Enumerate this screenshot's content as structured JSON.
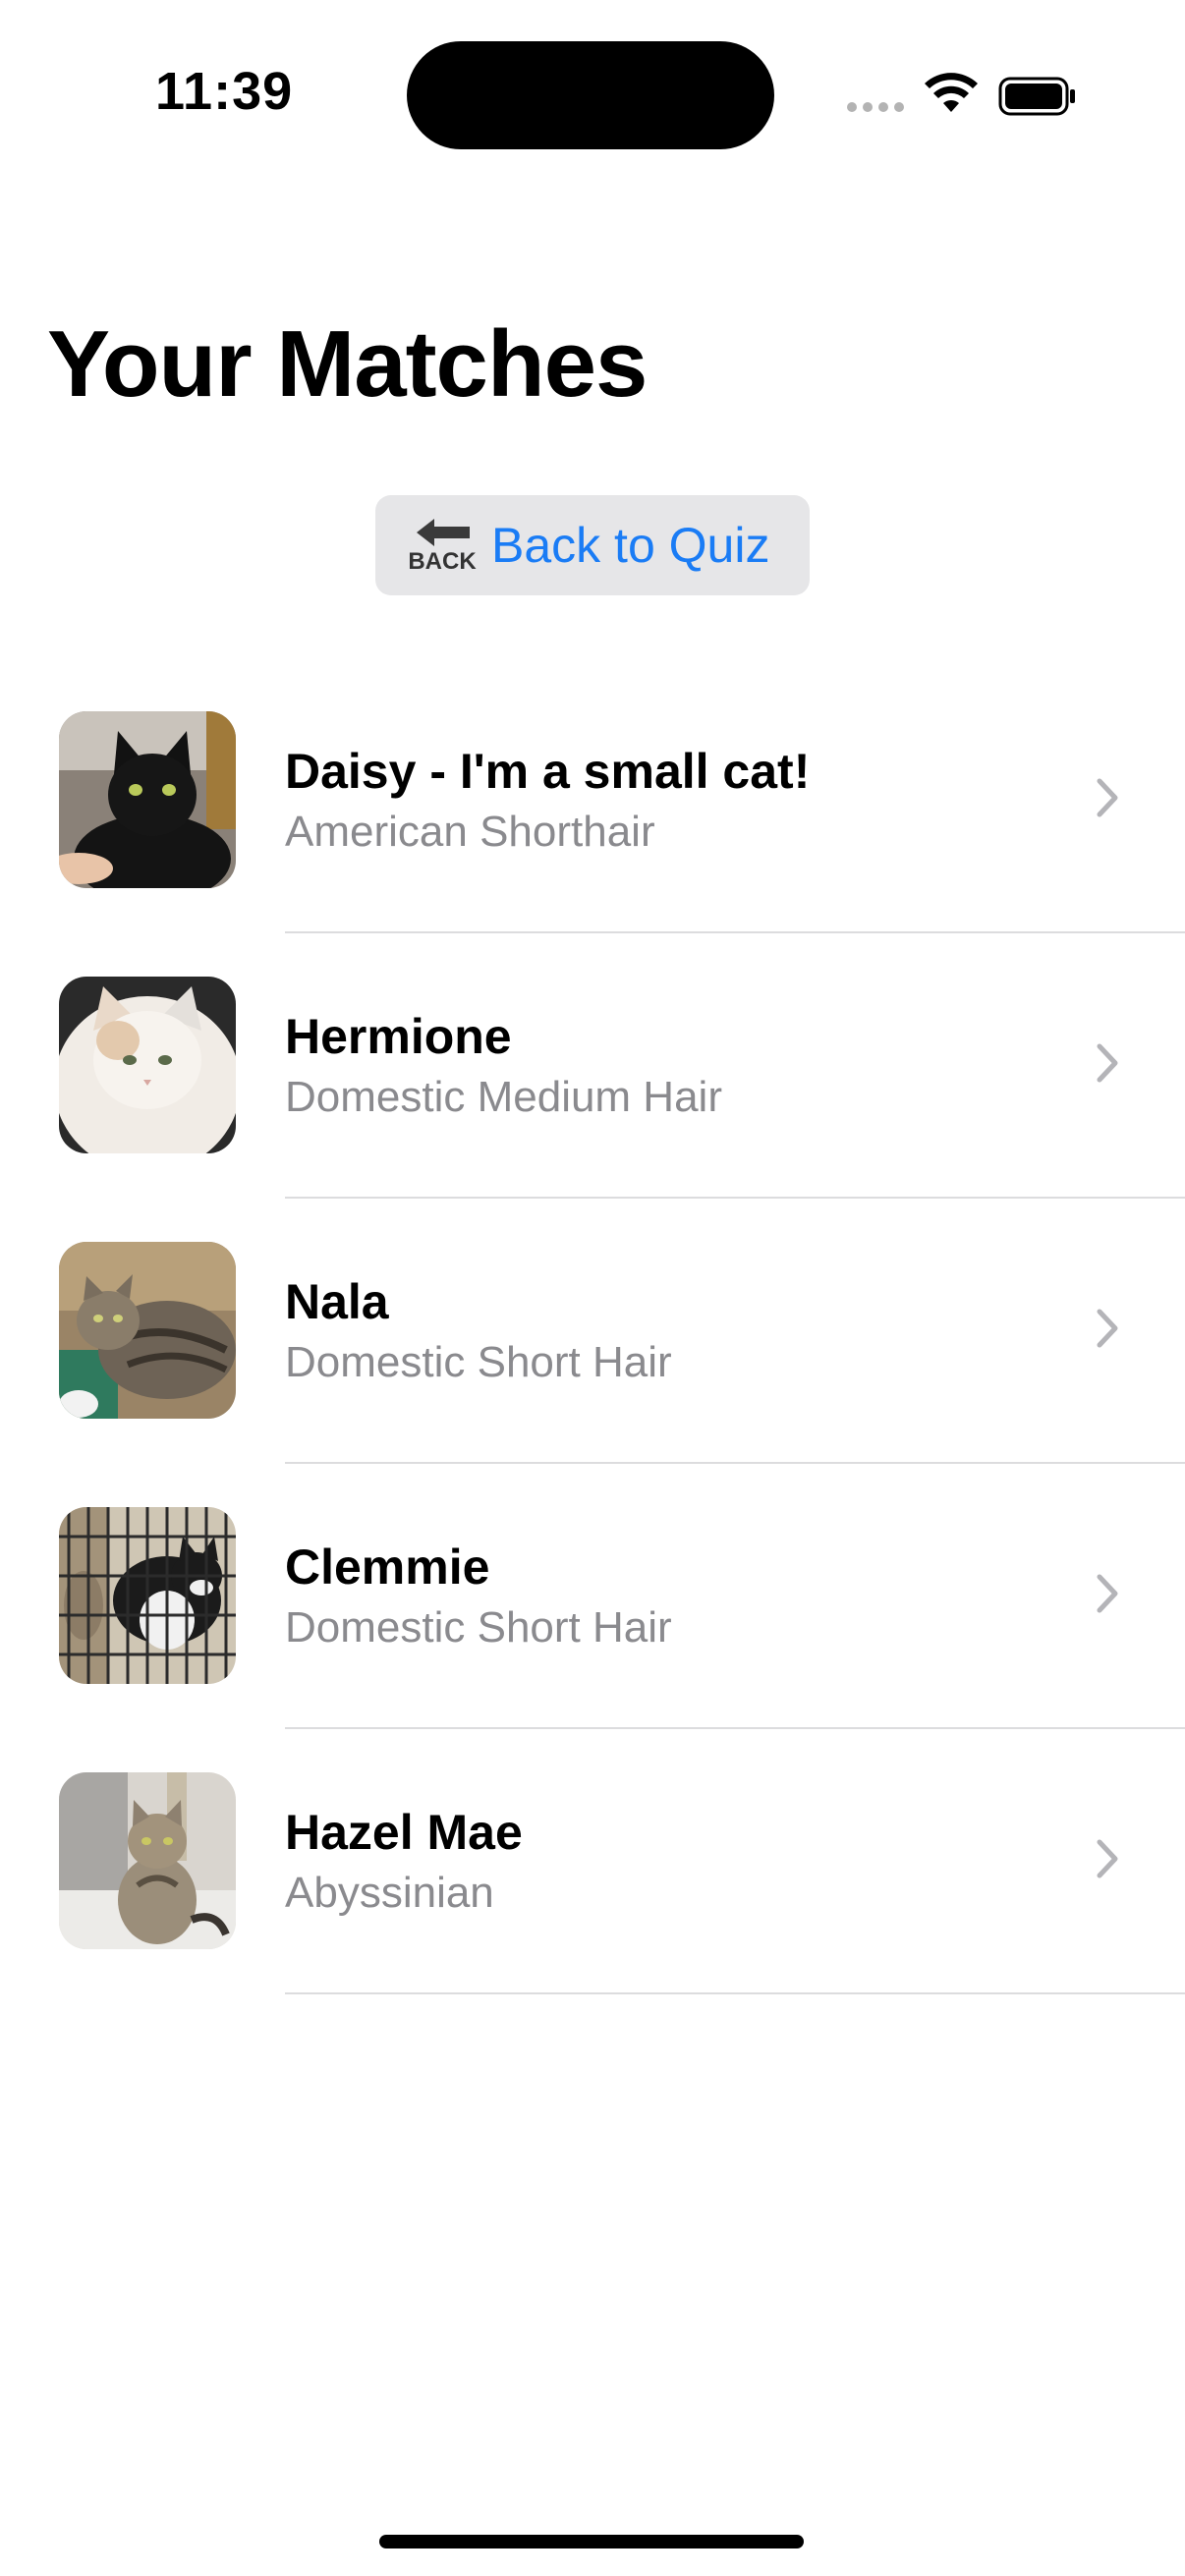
{
  "status_bar": {
    "time": "11:39",
    "icons": [
      "cellular-dots-icon",
      "wifi-icon",
      "battery-icon"
    ]
  },
  "header": {
    "title": "Your Matches"
  },
  "back_button": {
    "label": "Back to Quiz",
    "icon_text": "BACK",
    "icon": "back-arrow-icon",
    "color": "#1a7cf5"
  },
  "matches": [
    {
      "name": "Daisy - I'm a small cat!",
      "breed": "American Shorthair"
    },
    {
      "name": "Hermione",
      "breed": "Domestic Medium Hair"
    },
    {
      "name": "Nala",
      "breed": "Domestic Short Hair"
    },
    {
      "name": "Clemmie",
      "breed": "Domestic Short Hair"
    },
    {
      "name": "Hazel Mae",
      "breed": "Abyssinian"
    }
  ]
}
